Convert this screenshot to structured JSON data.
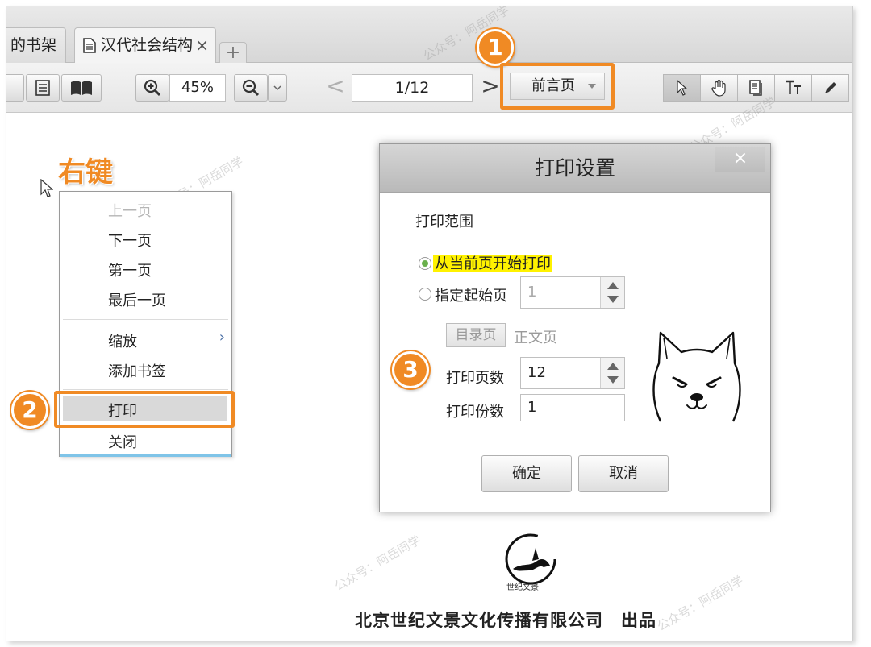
{
  "tabs": [
    {
      "label": "的书架"
    },
    {
      "label": "汉代社会结构",
      "close": "×"
    }
  ],
  "tab_add": "+",
  "toolbar": {
    "zoom_value": "45%",
    "page_value": "1/12",
    "prev_page_label": "前言页",
    "prev_arrow": "<",
    "next_arrow": ">"
  },
  "badges": {
    "one": "1",
    "two": "2",
    "three": "3"
  },
  "annotation": {
    "right_click": "右键"
  },
  "context_menu": {
    "items": [
      {
        "label": "上一页",
        "disabled": true
      },
      {
        "label": "下一页"
      },
      {
        "label": "第一页"
      },
      {
        "label": "最后一页"
      },
      {
        "label": "缩放",
        "submenu": "›"
      },
      {
        "label": "添加书签"
      },
      {
        "label": "打印"
      },
      {
        "label": "关闭"
      }
    ]
  },
  "dialog": {
    "title": "打印设置",
    "close": "×",
    "range_label": "打印范围",
    "option_from_current": "从当前页开始打印",
    "option_specify_start": "指定起始页",
    "start_page_value": "1",
    "toc_page": "目录页",
    "body_page": "正文页",
    "page_count_label": "打印页数",
    "page_count_value": "12",
    "copies_label": "打印份数",
    "copies_value": "1",
    "ok": "确定",
    "cancel": "取消"
  },
  "page_content": {
    "logo_caption": "世纪文景",
    "publisher": "北京世纪文景文化传播有限公司　出品"
  },
  "watermark": "公众号：阿岳同学",
  "colors": {
    "accent": "#f08a24",
    "highlight": "#fff200",
    "radio": "#6ab04c"
  }
}
